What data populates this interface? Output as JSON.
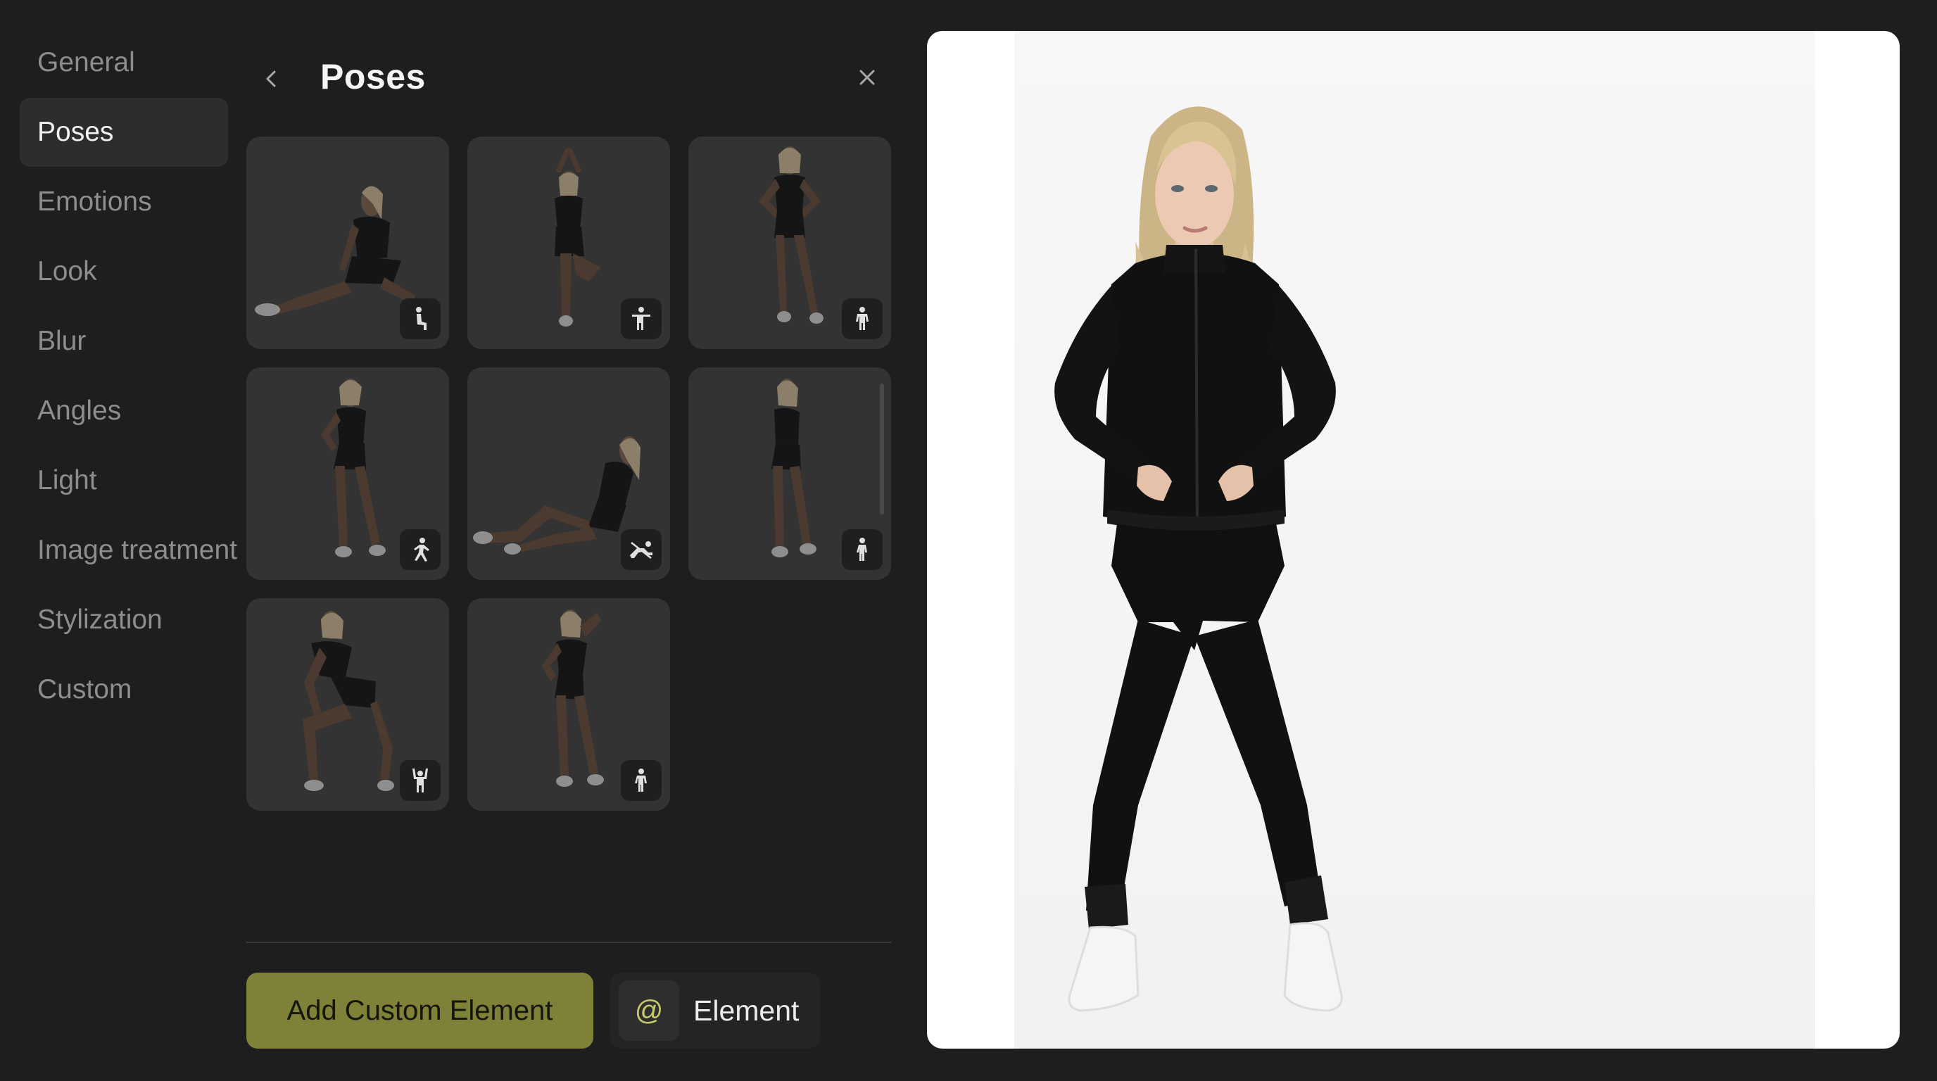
{
  "sidebar": {
    "items": [
      {
        "label": "General",
        "active": false
      },
      {
        "label": "Poses",
        "active": true
      },
      {
        "label": "Emotions",
        "active": false
      },
      {
        "label": "Look",
        "active": false
      },
      {
        "label": "Blur",
        "active": false
      },
      {
        "label": "Angles",
        "active": false
      },
      {
        "label": "Light",
        "active": false
      },
      {
        "label": "Image treatment",
        "active": false
      },
      {
        "label": "Stylization",
        "active": false
      },
      {
        "label": "Custom",
        "active": false
      }
    ]
  },
  "panel": {
    "title": "Poses",
    "back_icon": "chevron-left-icon",
    "close_icon": "close-icon",
    "poses": [
      {
        "name": "seated-floor",
        "badge_icon": "sitting-figure-icon"
      },
      {
        "name": "tree-pose-arms-up",
        "badge_icon": "arms-out-figure-icon"
      },
      {
        "name": "hands-on-hips",
        "badge_icon": "standing-figure-icon"
      },
      {
        "name": "side-step",
        "badge_icon": "walking-figure-icon"
      },
      {
        "name": "reclining",
        "badge_icon": "reclining-figure-icon"
      },
      {
        "name": "side-stance",
        "badge_icon": "standing-figure-icon"
      },
      {
        "name": "crouch",
        "badge_icon": "arms-up-figure-icon"
      },
      {
        "name": "hand-on-head",
        "badge_icon": "standing-figure-icon"
      }
    ]
  },
  "actions": {
    "add_custom_label": "Add Custom Element",
    "element_prefix": "@",
    "element_label": "Element"
  },
  "colors": {
    "background": "#1e1e1e",
    "active_nav": "#2d2d2d",
    "accent_button": "#7f8138",
    "tile": "#333333",
    "preview_bg": "#ffffff"
  }
}
